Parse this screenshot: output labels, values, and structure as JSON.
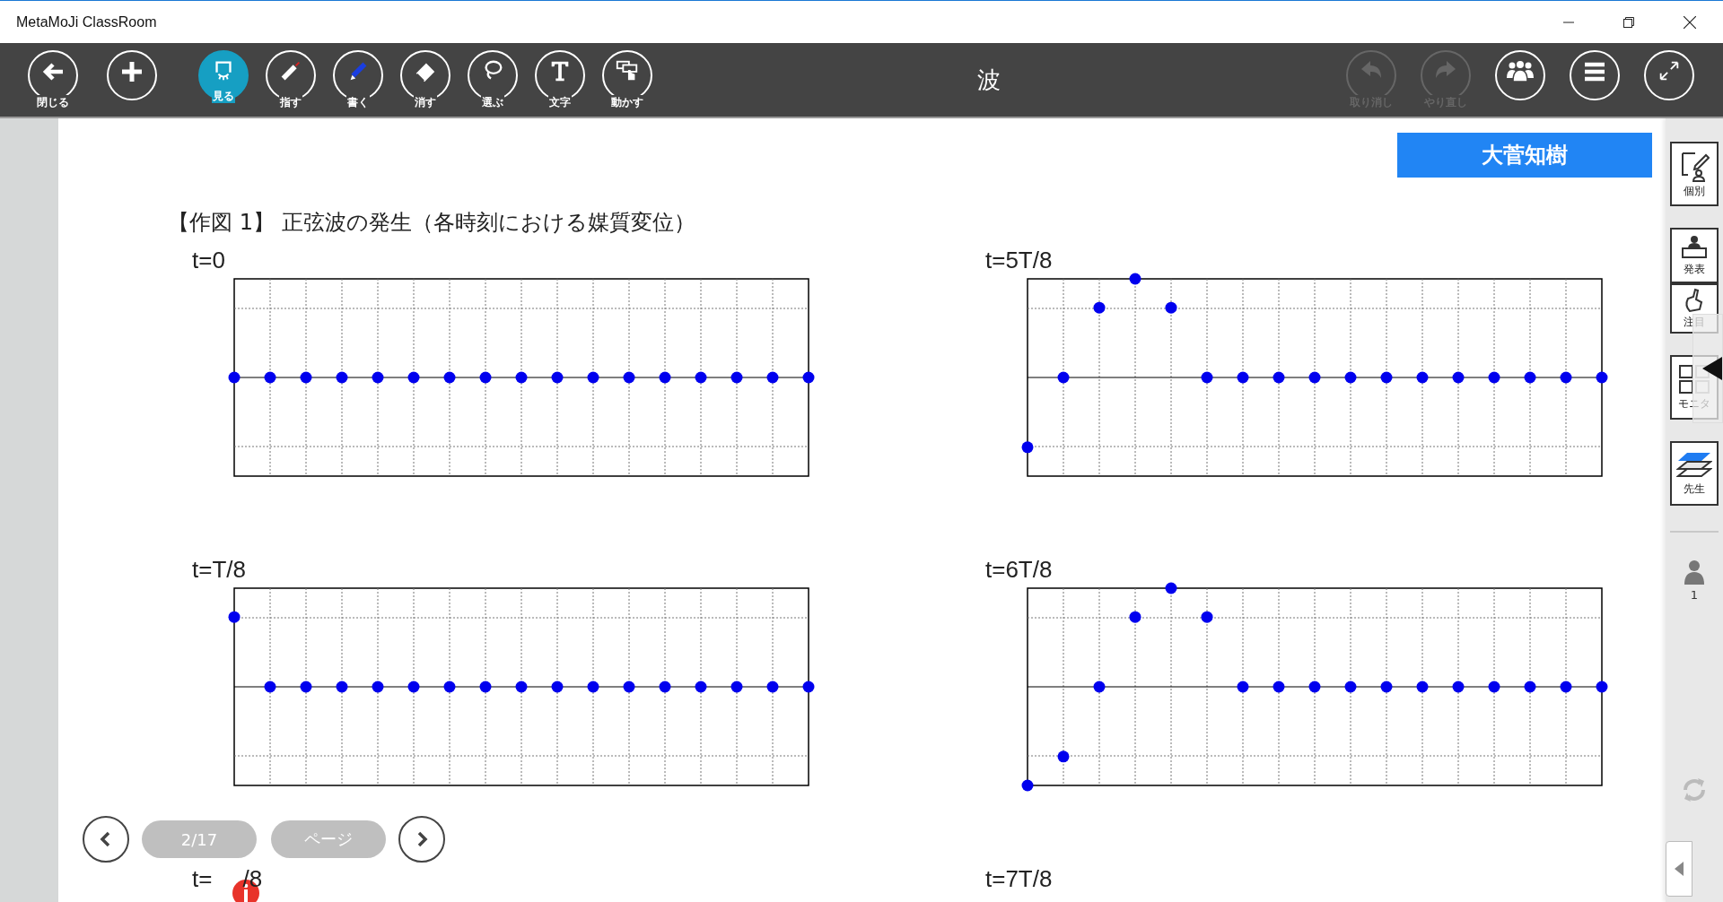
{
  "window": {
    "title": "MetaMoJi ClassRoom"
  },
  "toolbar": {
    "left": [
      {
        "kind": "back",
        "label": "閉じる",
        "selected": false
      },
      {
        "kind": "add",
        "selected": false
      },
      {
        "kind": "view",
        "label": "見る",
        "selected": true
      },
      {
        "kind": "point",
        "label": "指す",
        "selected": false
      },
      {
        "kind": "write",
        "label": "書く",
        "selected": false
      },
      {
        "kind": "erase",
        "label": "消す",
        "selected": false
      },
      {
        "kind": "select",
        "label": "選ぶ",
        "selected": false
      },
      {
        "kind": "text",
        "label": "文字",
        "selected": false
      },
      {
        "kind": "move",
        "label": "動かす",
        "selected": false
      }
    ],
    "title": "波",
    "right": [
      {
        "kind": "undo",
        "label": "取り消し",
        "disabled": true
      },
      {
        "kind": "redo",
        "label": "やり直し",
        "disabled": true
      },
      {
        "kind": "group",
        "disabled": false
      },
      {
        "kind": "menu",
        "disabled": false
      },
      {
        "kind": "expand",
        "disabled": false
      }
    ]
  },
  "user_badge": "大菅知樹",
  "worksheet": {
    "heading": "【作図 1】 正弦波の発生（各時刻における媒質変位）",
    "plots": [
      {
        "label": "t=0"
      },
      {
        "label": "t=5T/8"
      },
      {
        "label": "t=T/8"
      },
      {
        "label": "t=6T/8"
      }
    ],
    "cut_labels": [
      {
        "start": "t=",
        "end": "/8"
      },
      {
        "start": "t=7T/8"
      }
    ]
  },
  "pager": {
    "page": "2/17",
    "page_button": "ページ"
  },
  "sidebar": {
    "items": [
      {
        "kind": "individual",
        "label": "個別"
      },
      {
        "kind": "present",
        "label": "発表"
      },
      {
        "kind": "attention",
        "label": "注目"
      },
      {
        "kind": "monitor",
        "label": "モニタ"
      },
      {
        "kind": "teacher",
        "label": "先生"
      }
    ],
    "participants": "1"
  }
}
